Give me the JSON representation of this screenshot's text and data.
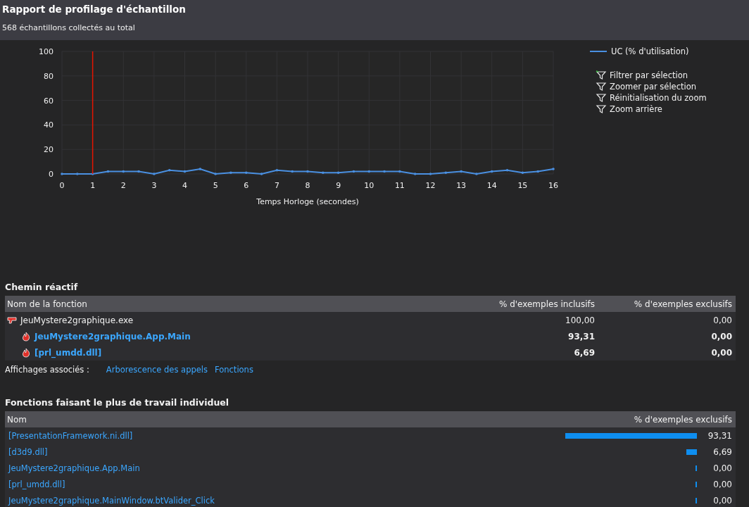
{
  "header": {
    "title": "Rapport de profilage d'échantillon",
    "subtitle": "568 échantillons collectés au total"
  },
  "chart": {
    "actions": [
      {
        "label": "Filtrer par sélection",
        "kind": "flagged"
      },
      {
        "label": "Zoomer par sélection",
        "kind": "plain"
      },
      {
        "label": "Réinitialisation du zoom",
        "kind": "plain"
      },
      {
        "label": "Zoom arrière",
        "kind": "plain"
      }
    ],
    "chart_data": {
      "type": "line",
      "xlabel": "Temps Horloge (secondes)",
      "x": [
        0,
        0.5,
        1,
        1.5,
        2,
        2.5,
        3,
        3.5,
        4,
        4.5,
        5,
        5.5,
        6,
        6.5,
        7,
        7.5,
        8,
        8.5,
        9,
        9.5,
        10,
        10.5,
        11,
        11.5,
        12,
        12.5,
        13,
        13.5,
        14,
        14.5,
        15,
        15.5,
        16
      ],
      "series": [
        {
          "name": "UC (% d'utilisation)",
          "color": "#4a90e2",
          "values": [
            0,
            0,
            0,
            2,
            2,
            2,
            0,
            3,
            2,
            4,
            0,
            1,
            1,
            0,
            3,
            2,
            2,
            1,
            1,
            2,
            2,
            2,
            2,
            0,
            0,
            1,
            2,
            0,
            2,
            3,
            1,
            2,
            4
          ]
        }
      ],
      "xlim": [
        0,
        16
      ],
      "ylim": [
        0,
        100
      ],
      "xticks": [
        0,
        1,
        2,
        3,
        4,
        5,
        6,
        7,
        8,
        9,
        10,
        11,
        12,
        13,
        14,
        15,
        16
      ],
      "yticks": [
        0,
        20,
        40,
        60,
        80,
        100
      ],
      "grid": true,
      "ref_lines": [
        {
          "axis": "x",
          "value": 1,
          "color": "#e51400"
        }
      ]
    }
  },
  "hot_path": {
    "title": "Chemin réactif",
    "columns": [
      "Nom de la fonction",
      "% d'exemples inclusifs",
      "% d'exemples exclusifs"
    ],
    "rows": [
      {
        "kind": "root",
        "name": "JeuMystere2graphique.exe",
        "inclusive": "100,00",
        "exclusive": "0,00"
      },
      {
        "kind": "hot",
        "name": "JeuMystere2graphique.App.Main",
        "inclusive": "93,31",
        "exclusive": "0,00"
      },
      {
        "kind": "hot",
        "name": "[prl_umdd.dll]",
        "inclusive": "6,69",
        "exclusive": "0,00"
      }
    ],
    "related_label": "Affichages associés :",
    "related_links": [
      "Arborescence des appels",
      "Fonctions"
    ]
  },
  "top_functions": {
    "title": "Fonctions faisant le plus de travail individuel",
    "columns": [
      "Nom",
      "% d'exemples exclusifs"
    ],
    "rows": [
      {
        "name": "[PresentationFramework.ni.dll]",
        "level": 0.9331,
        "value": "93,31"
      },
      {
        "name": "[d3d9.dll]",
        "level": 0.0669,
        "value": "6,69"
      },
      {
        "name": "JeuMystere2graphique.App.Main",
        "level": 0,
        "value": "0,00"
      },
      {
        "name": "[prl_umdd.dll]",
        "level": 0,
        "value": "0,00"
      },
      {
        "name": "JeuMystere2graphique.MainWindow.btValider_Click",
        "level": 0,
        "value": "0,00"
      }
    ]
  }
}
